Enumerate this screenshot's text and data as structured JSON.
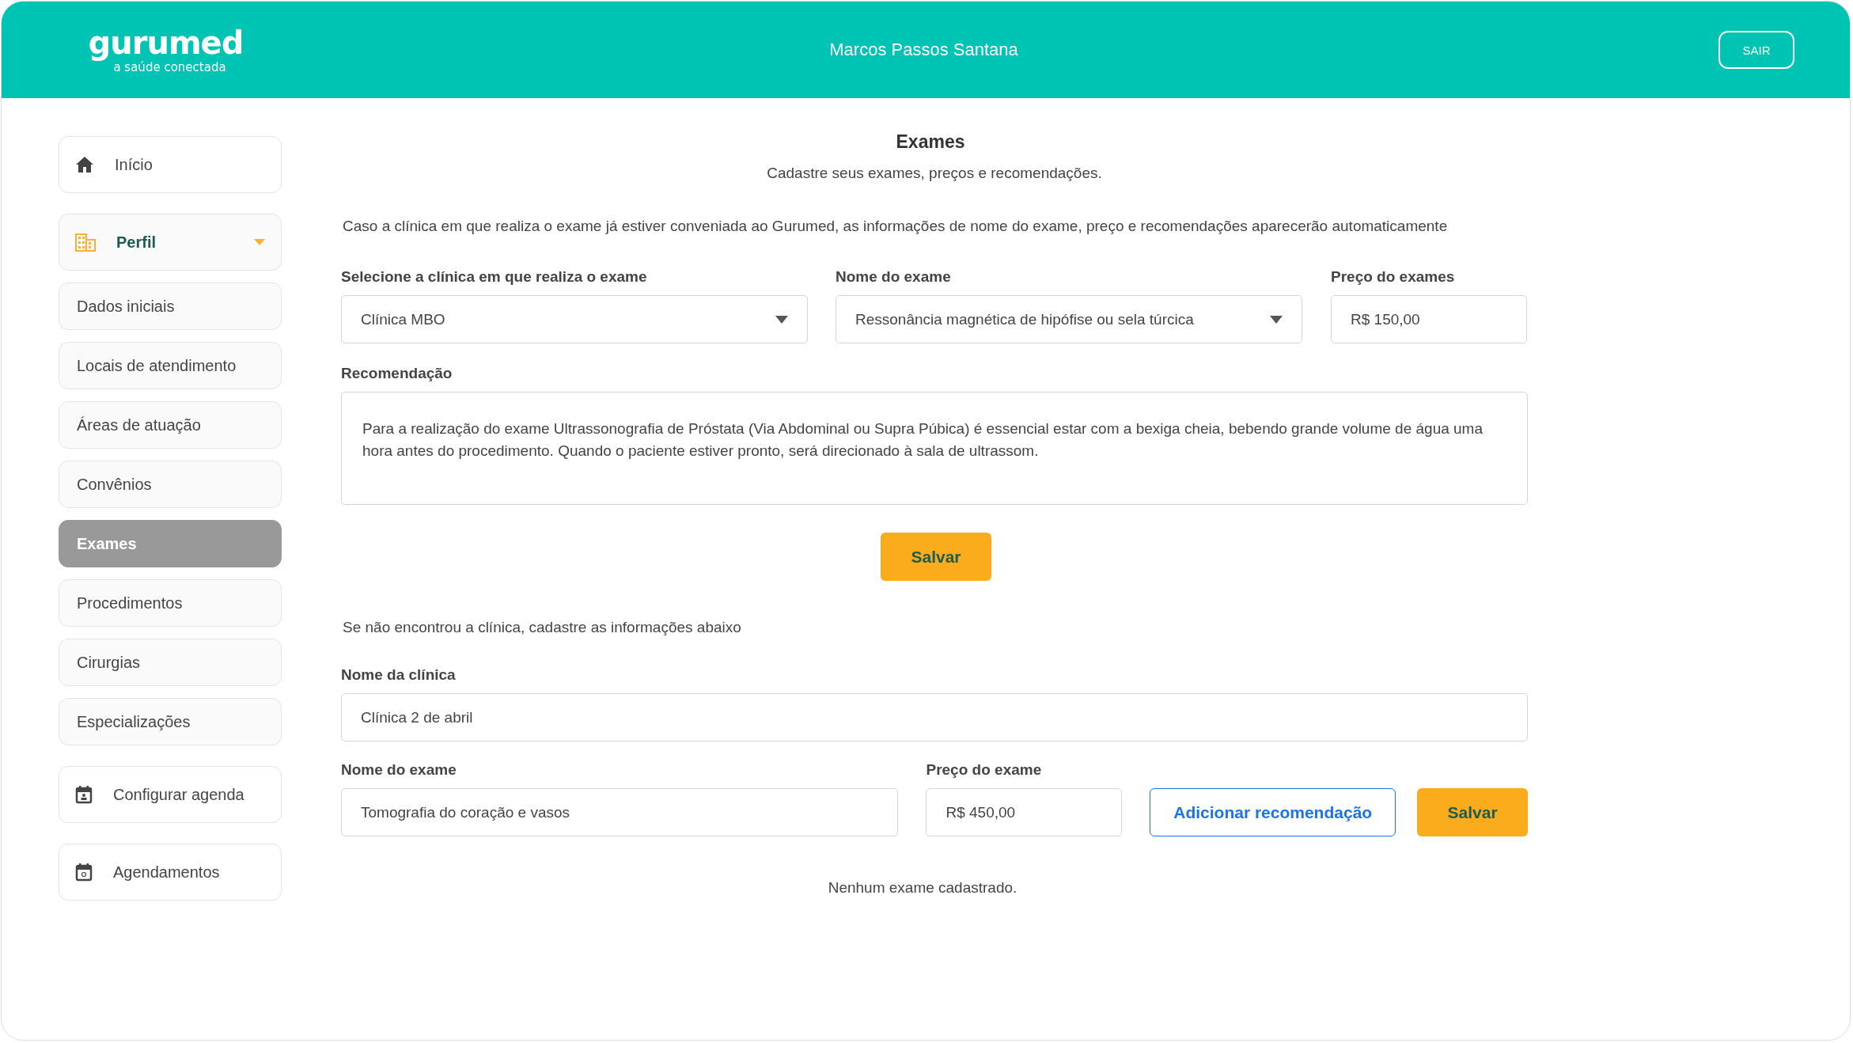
{
  "header": {
    "logo": {
      "name": "gurumed",
      "tagline": "a saúde conectada"
    },
    "user_name": "Marcos Passos Santana",
    "logout_button": "SAIR"
  },
  "sidebar": {
    "items": [
      {
        "kind": "link",
        "label": "Início",
        "selected": false
      },
      {
        "kind": "group",
        "label": "Perfil",
        "selected": false,
        "expanded": true,
        "children": [
          {
            "label": "Dados iniciais",
            "selected": false
          },
          {
            "label": "Locais de atendimento",
            "selected": false
          },
          {
            "label": "Áreas de atuação",
            "selected": false
          },
          {
            "label": "Convênios",
            "selected": false
          },
          {
            "label": "Exames",
            "selected": true
          },
          {
            "label": "Procedimentos",
            "selected": false
          },
          {
            "label": "Cirurgias",
            "selected": false
          },
          {
            "label": "Especializações",
            "selected": false
          }
        ]
      },
      {
        "kind": "link",
        "label": "Configurar agenda",
        "selected": false
      },
      {
        "kind": "link",
        "label": "Agendamentos",
        "selected": false
      }
    ]
  },
  "main": {
    "title": "Exames",
    "subtitle": "Cadastre seus exames, preços e recomendações.",
    "notice": "Caso a clínica em que realiza o exame já estiver conveniada ao Gurumed, as informações de nome do exame, preço e recomendações aparecerão automaticamente",
    "existing_form": {
      "clinic": {
        "label": "Selecione a clínica em que realiza o exame",
        "value": "Clínica MBO"
      },
      "exam": {
        "label": "Nome do exame",
        "value": "Ressonância magnética de hipófise ou sela túrcica"
      },
      "price": {
        "label": "Preço do exames",
        "value": "R$ 150,00"
      },
      "recommendation": {
        "label": "Recomendação",
        "value": "Para a realização do exame Ultrassonografia de Próstata (Via Abdominal ou Supra Púbica) é essencial estar com a bexiga cheia, bebendo grande volume de água uma hora antes do procedimento. Quando o paciente estiver pronto, será direcionado à sala de ultrassom."
      },
      "save_button": "Salvar"
    },
    "new_clinic_form": {
      "prompt": "Se não encontrou a clínica, cadastre as informações abaixo",
      "clinic_name": {
        "label": "Nome da clínica",
        "value": "Clínica 2 de abril"
      },
      "exam_name": {
        "label": "Nome do exame",
        "value": "Tomografia do coração e vasos"
      },
      "price": {
        "label": "Preço do exame",
        "value": "R$ 450,00"
      },
      "add_recommendation_button": "Adicionar recomendação",
      "save_button": "Salvar"
    },
    "empty_message": "Nenhum exame cadastrado."
  }
}
